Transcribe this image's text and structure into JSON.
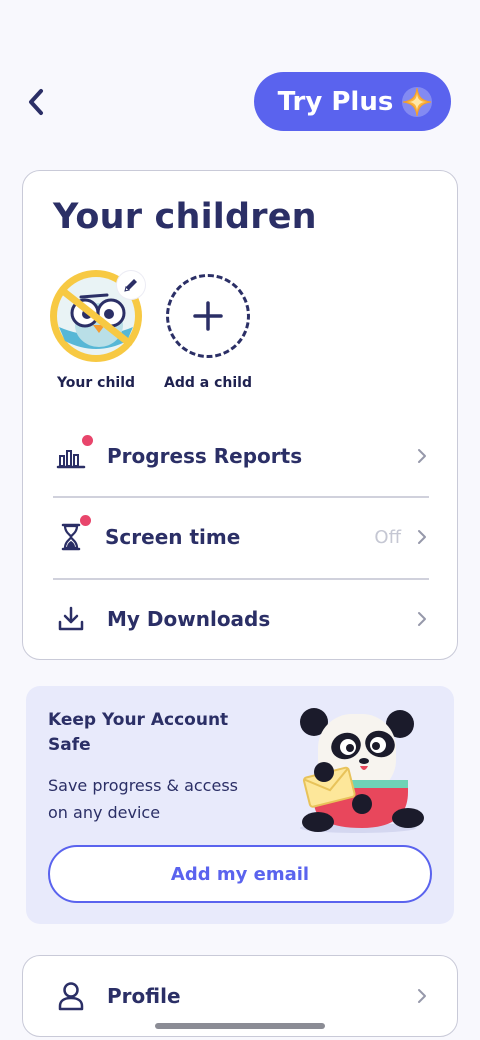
{
  "header": {
    "back_icon": "chevron-left-icon",
    "try_plus_label": "Try Plus",
    "plus_icon": "sparkle-icon"
  },
  "children": {
    "title": "Your children",
    "items": [
      {
        "label": "Your child",
        "avatar_icon": "owl-avatar-icon",
        "edit_icon": "pencil-icon"
      },
      {
        "label": "Add a child",
        "icon": "plus-icon"
      }
    ]
  },
  "menu": [
    {
      "label": "Progress Reports",
      "icon": "bar-chart-icon",
      "value": "",
      "has_dot": true
    },
    {
      "label": "Screen time",
      "icon": "hourglass-icon",
      "value": "Off",
      "has_dot": true
    },
    {
      "label": "My Downloads",
      "icon": "download-icon",
      "value": "",
      "has_dot": false
    }
  ],
  "account_safe": {
    "title": "Keep Your Account Safe",
    "description": "Save progress & access on any device",
    "button_label": "Add my email",
    "illustration": "panda-with-envelope"
  },
  "profile": {
    "label": "Profile",
    "icon": "person-icon"
  },
  "colors": {
    "accent": "#5a63ee",
    "text": "#2b2f66",
    "notification_dot": "#e8456b",
    "safe_card_bg": "#e8eafb",
    "page_bg": "#f8f8fd"
  }
}
